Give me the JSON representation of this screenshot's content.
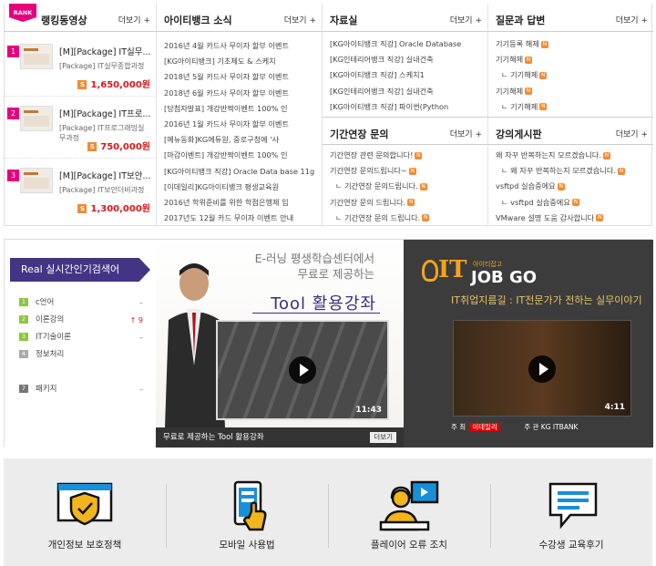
{
  "ranking": {
    "badge": "RANK",
    "title": "랭킹동영상",
    "more": "더보기 +",
    "items": [
      {
        "num": "1",
        "title": "[M][Package] IT실무...",
        "sub": "[Package] IT실무종합과정",
        "price": "1,650,000원",
        "price_icon": "S"
      },
      {
        "num": "2",
        "title": "[M][Package] IT프로...",
        "sub": "[Package] IT프로그래밍실무과정",
        "price": "750,000원",
        "price_icon": "S"
      },
      {
        "num": "3",
        "title": "[M][Package] IT보안...",
        "sub": "[Package] IT보안더비과정",
        "price": "1,300,000원",
        "price_icon": "S"
      }
    ]
  },
  "news": {
    "title": "아이티뱅크 소식",
    "more": "더보기 +",
    "items": [
      "2016년 4월 카드사 무이자 할부 이벤트",
      "[KG아이티뱅크] 기초제도 & 스케치",
      "2018년 5월 카드사 무이자 할부 이벤트",
      "2018년 6월 카드사 무이자 할부 이벤트",
      "[당첨자발표] 개강반짝이벤트 100% 인",
      "2016년 1월 카드사 무이자 할부 이벤트",
      "[메뉴동화]KG에듀원, 중로구청에 '사",
      "[마감이벤트] 개강반짝이벤트 100% 인",
      "[KG아이티뱅크 직강] Oracle Data base 11g",
      "[이데일리]KG아이티뱅크 평생교육원",
      "2016년 학위준비를 위한 학점은행제 입",
      "2017년도 12월 카드 무이자 이벤트 안내"
    ]
  },
  "data_room": {
    "title": "자료실",
    "more": "더보기 +",
    "items": [
      "[KG아이티뱅크 직강] Oracle Database",
      "[KG인테리어뱅크 직강] 실내건축",
      "[KG아이티뱅크 직강] 스케치1",
      "[KG인테리어뱅크 직강] 실내건축",
      "[KG아이티뱅크 직강] 파이썬(Python"
    ]
  },
  "period": {
    "title": "기간연장 문의",
    "more": "더보기 +",
    "items": [
      "기간연장 관련 문의합니다!",
      "기간연장 문의드립니다~",
      "ㄴ 기간연장 문의드립니다.",
      "기간연장 문의 드립니다.",
      "ㄴ 기간연장 문의 드립니다."
    ]
  },
  "qna": {
    "title": "질문과 답변",
    "more": "더보기 +",
    "items": [
      "기기등록 해제",
      "기기해제",
      "ㄴ 기기해제",
      "기기해제",
      "ㄴ 기기해제"
    ]
  },
  "lecture_board": {
    "title": "강의게시판",
    "more": "더보기 +",
    "items": [
      "왜 자꾸 반복하는지 모르겠습니다.",
      "ㄴ 왜 자꾸 반복하는지 모르겠습니다.",
      "vsftpd 실습중에요",
      "ㄴ vsftpd 실습중에요",
      "VMware 설명 도움 감사합니다"
    ]
  },
  "keywords": {
    "title": "Real 실시간인기검색어",
    "items": [
      {
        "rank": "1",
        "text": "c언어",
        "change": "–",
        "color": "#8dc63f"
      },
      {
        "rank": "2",
        "text": "이론강의",
        "change": "↑ 9",
        "color": "#8dc63f"
      },
      {
        "rank": "3",
        "text": "IT기술이론",
        "change": "–",
        "color": "#8dc63f"
      },
      {
        "rank": "4",
        "text": "정보처리",
        "change": "",
        "color": "#aaa"
      },
      {
        "rank": "",
        "text": "",
        "change": "",
        "color": "#fff"
      },
      {
        "rank": "7",
        "text": "패키지",
        "change": "–",
        "color": "#777"
      }
    ]
  },
  "video1": {
    "headline1": "E-러닝 평생학습센터에서",
    "headline2": "무료로 제공하는",
    "headline3": "Tool 활용강좌",
    "duration": "11:43",
    "caption": "무료로 제공하는 Tool 활용강좌",
    "more": "더보기"
  },
  "video2": {
    "logo_small": "아이티잡고",
    "logo_it": "IT",
    "logo_job": "JOB GO",
    "tagline": "IT취업지름길 : IT전문가가 전하는 실무이야기",
    "duration": "4:11",
    "host_label": "주 최",
    "host": "이데일리",
    "org_label": "주 관",
    "org": "KG ITBANK"
  },
  "footer": {
    "items": [
      {
        "label": "개인정보 보호정책",
        "icon": "shield-check-icon"
      },
      {
        "label": "모바일 사용법",
        "icon": "mobile-hand-icon"
      },
      {
        "label": "플레이어 오류 조치",
        "icon": "player-support-icon"
      },
      {
        "label": "수강생 교육후기",
        "icon": "chat-bubble-icon"
      }
    ]
  }
}
